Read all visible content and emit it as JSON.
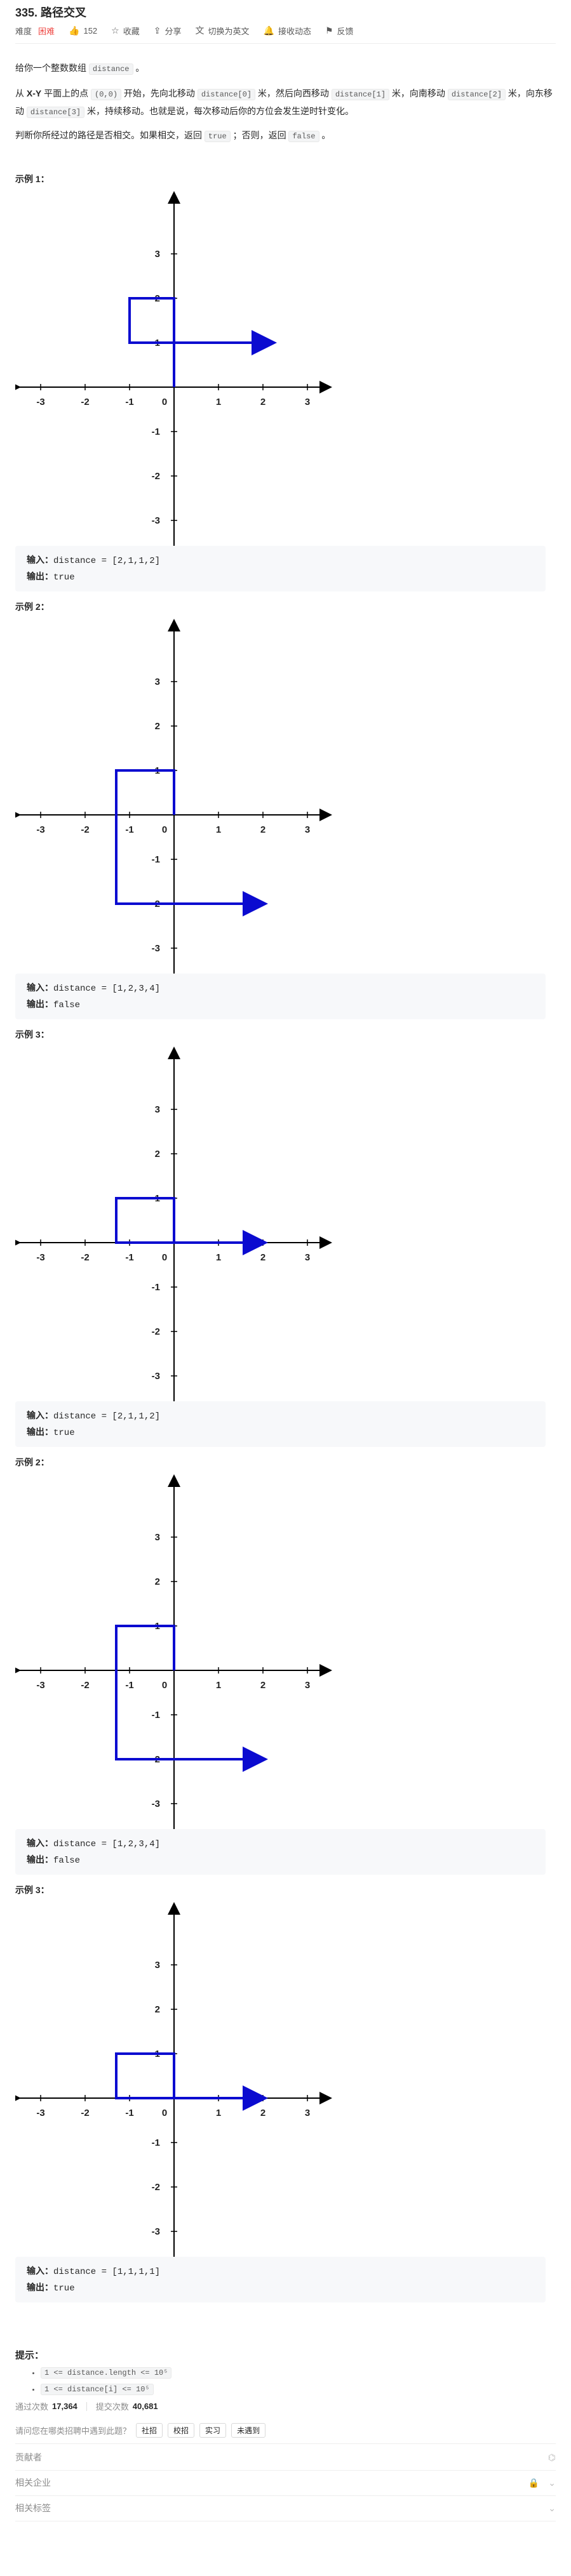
{
  "header": {
    "title": "335. 路径交叉",
    "difficulty_label": "难度",
    "difficulty": "困难",
    "likes": "152",
    "favorite": "收藏",
    "share": "分享",
    "translate": "切换为英文",
    "notify": "接收动态",
    "feedback": "反馈"
  },
  "description": {
    "p1_a": "给你一个整数数组",
    "p1_code": "distance",
    "p1_b": "。",
    "p2_a": "从",
    "p2_bold": "X-Y",
    "p2_b": "平面上的点",
    "p2_code1": "(0,0)",
    "p2_c": "开始，先向北移动",
    "p2_code2": "distance[0]",
    "p2_d": "米，然后向西移动",
    "p2_code3": "distance[1]",
    "p2_e": "米，向南移动",
    "p2_code4": "distance[2]",
    "p2_f": "米，向东移动",
    "p2_code5": "distance[3]",
    "p2_g": "米，持续移动。也就是说，每次移动后你的方位会发生逆时针变化。",
    "p3_a": "判断你所经过的路径是否相交。如果相交，返回",
    "p3_code1": "true",
    "p3_b": "；否则，返回",
    "p3_code2": "false",
    "p3_c": "。"
  },
  "examples": [
    {
      "title": "示例 1：",
      "input_label": "输入：",
      "input": "distance = [2,1,1,2]",
      "output_label": "输出：",
      "output": "true",
      "path": [
        [
          0,
          0
        ],
        [
          0,
          2
        ],
        [
          -1,
          2
        ],
        [
          -1,
          1
        ],
        [
          2.2,
          1
        ]
      ]
    },
    {
      "title": "示例 2：",
      "input_label": "输入：",
      "input": "distance = [1,2,3,4]",
      "output_label": "输出：",
      "output": "false",
      "path": [
        [
          0,
          0
        ],
        [
          0,
          1
        ],
        [
          -1.3,
          1
        ],
        [
          -1.3,
          -2
        ],
        [
          2,
          -2
        ]
      ]
    },
    {
      "title": "示例 3：",
      "input_label": "输入：",
      "input": "distance = [2,1,1,2]",
      "output_label": "输出：",
      "output": "true",
      "path": [
        [
          0,
          0
        ],
        [
          0,
          1
        ],
        [
          -1.3,
          1
        ],
        [
          -1.3,
          0
        ],
        [
          2,
          0
        ]
      ]
    },
    {
      "title": "示例 2：",
      "input_label": "输入：",
      "input": "distance = [1,2,3,4]",
      "output_label": "输出：",
      "output": "false",
      "path": [
        [
          0,
          0
        ],
        [
          0,
          1
        ],
        [
          -1.3,
          1
        ],
        [
          -1.3,
          -2
        ],
        [
          2,
          -2
        ]
      ]
    },
    {
      "title": "示例 3：",
      "input_label": "输入：",
      "input": "distance = [1,1,1,1]",
      "output_label": "输出：",
      "output": "true",
      "path": [
        [
          0,
          0
        ],
        [
          0,
          1
        ],
        [
          -1.3,
          1
        ],
        [
          -1.3,
          0
        ],
        [
          2,
          0
        ]
      ]
    }
  ],
  "axis": {
    "x_ticks": [
      "-3",
      "-2",
      "-1",
      "0",
      "1",
      "2",
      "3"
    ],
    "y_ticks": [
      "3",
      "2",
      "1",
      "-1",
      "-2",
      "-3"
    ],
    "line_color": "#0b0bd0"
  },
  "hints": {
    "title": "提示：",
    "items": [
      "1 <= distance.length <= 10⁵",
      "1 <= distance[i] <= 10⁵"
    ]
  },
  "stats": {
    "passed_label": "通过次数",
    "passed": "17,364",
    "submitted_label": "提交次数",
    "submitted": "40,681"
  },
  "interview": {
    "question": "请问您在哪类招聘中遇到此题？",
    "tags": [
      "社招",
      "校招",
      "实习",
      "未遇到"
    ]
  },
  "rows": {
    "contributors": "贡献者",
    "companies": "相关企业",
    "topics": "相关标签"
  }
}
